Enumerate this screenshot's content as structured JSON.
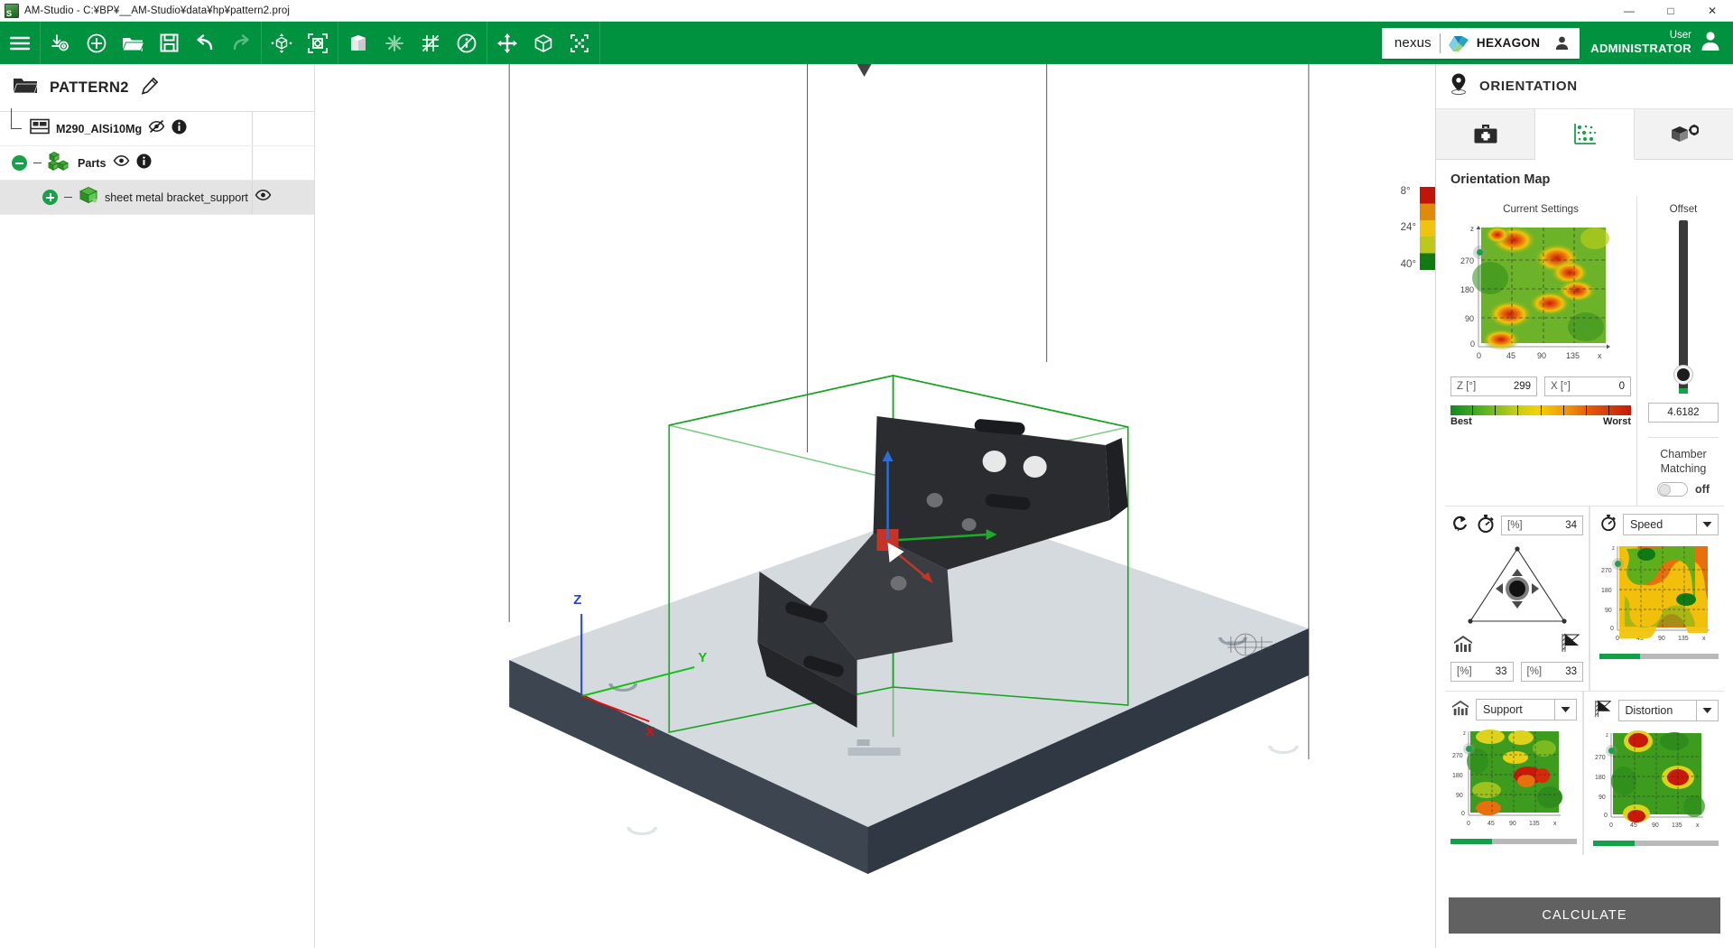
{
  "window": {
    "title": "AM-Studio - C:¥BP¥__AM-Studio¥data¥hp¥pattern2.proj",
    "minimize": "—",
    "maximize": "□",
    "close": "✕"
  },
  "toolbar": {
    "groups": [
      {
        "items": [
          {
            "name": "menu-icon",
            "label": "Menu"
          }
        ]
      },
      {
        "items": [
          {
            "name": "import-icon",
            "label": "Import"
          },
          {
            "name": "add-icon",
            "label": "Add"
          },
          {
            "name": "open-folder-icon",
            "label": "Open"
          },
          {
            "name": "save-icon",
            "label": "Save"
          },
          {
            "name": "undo-icon",
            "label": "Undo"
          },
          {
            "name": "redo-icon",
            "label": "Redo"
          }
        ]
      },
      {
        "items": [
          {
            "name": "orbit-cube-icon",
            "label": "Rotate View"
          },
          {
            "name": "fit-view-icon",
            "label": "Fit To View"
          }
        ]
      },
      {
        "items": [
          {
            "name": "solid-view-icon",
            "label": "Solid View"
          },
          {
            "name": "slice-icon",
            "label": "Slice"
          },
          {
            "name": "grid-icon",
            "label": "Grid"
          },
          {
            "name": "info-disabled-icon",
            "label": "Info Off"
          }
        ]
      },
      {
        "items": [
          {
            "name": "move-icon",
            "label": "Move"
          },
          {
            "name": "box-icon",
            "label": "Bounding Box"
          },
          {
            "name": "select-icon",
            "label": "Select"
          }
        ]
      }
    ],
    "brand": {
      "nexus": "nexus",
      "hexagon": "HEXAGON"
    },
    "user": {
      "caption": "User",
      "name": "ADMINISTRATOR"
    }
  },
  "tree": {
    "project_name": "PATTERN2",
    "edit_icon": "pencil-icon",
    "rows": [
      {
        "label": "M290_AlSi10Mg",
        "indent": 1,
        "bold": true,
        "icon": "machine-icon",
        "eye": "hidden",
        "info": true,
        "toggle": "none",
        "selected": false
      },
      {
        "label": "Parts",
        "indent": 0,
        "bold": true,
        "icon": "parts-icon",
        "eye": "visible",
        "info": true,
        "toggle": "minus",
        "selected": false
      },
      {
        "label": "sheet metal bracket_support",
        "indent": 2,
        "bold": false,
        "icon": "part-icon",
        "eye": "visible",
        "info": false,
        "toggle": "plus",
        "selected": true
      }
    ]
  },
  "viewport": {
    "axes": {
      "x": "X",
      "y": "Y",
      "z": "Z"
    },
    "legend": {
      "title": "angle-legend",
      "labels": [
        "8°",
        "24°",
        "40°"
      ]
    }
  },
  "panel": {
    "header_icon": "orientation-pin-icon",
    "header_title": "ORIENTATION",
    "tabs": [
      {
        "name": "tab-toolkit",
        "icon": "toolbox-icon",
        "active": false
      },
      {
        "name": "tab-orientation-map",
        "icon": "scatter-plot-icon",
        "active": true
      },
      {
        "name": "tab-part-settings",
        "icon": "box-gear-icon",
        "active": false
      }
    ],
    "section_title": "Orientation Map",
    "current_settings": {
      "title": "Current Settings",
      "z_label": "Z [°]",
      "z_value": "299",
      "x_label": "X [°]",
      "x_value": "0"
    },
    "offset": {
      "title": "Offset",
      "value": "4.6182"
    },
    "chamber_matching": {
      "line1": "Chamber",
      "line2": "Matching",
      "state": "off"
    },
    "quality_scale": {
      "best": "Best",
      "worst": "Worst"
    },
    "weights": {
      "reset_icon": "reset-icon",
      "time": {
        "icon": "stopwatch-icon",
        "unit": "[%]",
        "value": "34"
      },
      "support": {
        "icon": "support-icon",
        "unit": "[%]",
        "value": "33"
      },
      "distortion": {
        "icon": "distortion-flag-icon",
        "unit": "[%]",
        "value": "33"
      }
    },
    "maps": [
      {
        "name": "speed-map",
        "icon": "stopwatch-icon",
        "dropdown": "Speed",
        "progress": 34
      },
      {
        "name": "support-map",
        "icon": "support-icon",
        "dropdown": "Support",
        "progress": 33
      },
      {
        "name": "distortion-map",
        "icon": "distortion-flag-icon",
        "dropdown": "Distortion",
        "progress": 33
      }
    ],
    "calculate_label": "CALCULATE"
  },
  "chart_data": {
    "type": "heatmap",
    "xlabel": "x",
    "ylabel": "z",
    "xticks": [
      "0",
      "45",
      "90",
      "135"
    ],
    "yticks": [
      "0",
      "90",
      "180",
      "270"
    ],
    "xlim": [
      0,
      180
    ],
    "ylim": [
      0,
      360
    ],
    "grid": true,
    "colorscale": [
      "#0f7a14",
      "#5fae1c",
      "#c9d018",
      "#f2c40b",
      "#e8700c",
      "#c9190a"
    ],
    "marker": {
      "x": 0,
      "z": 299,
      "color": "#1fa04a",
      "label": "current orientation"
    },
    "maps": [
      "Current Settings",
      "Speed",
      "Support",
      "Distortion"
    ]
  },
  "colors": {
    "brand_green": "#00923f",
    "tree_green": "#1aa04a",
    "calculate_grey": "#616161",
    "heat_best": "#0f7a14",
    "heat_worst": "#c9190a"
  }
}
